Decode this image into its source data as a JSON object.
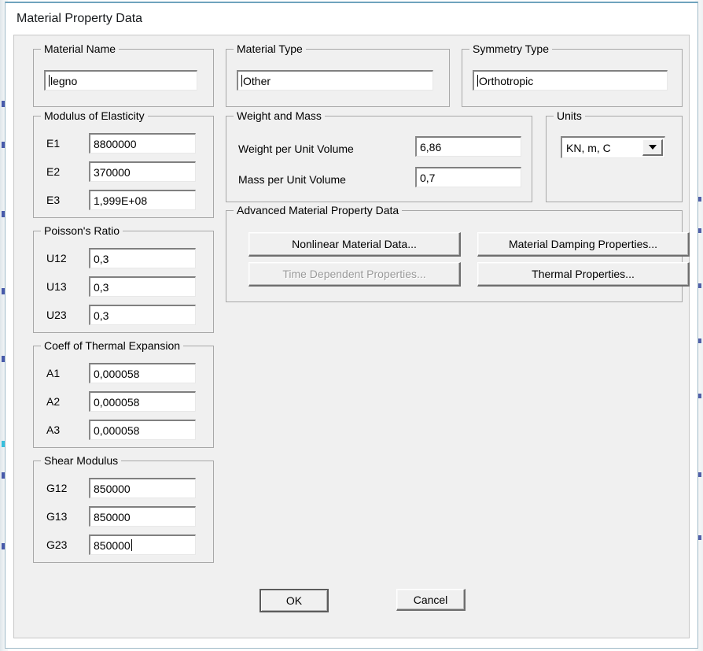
{
  "window": {
    "title": "Material Property Data"
  },
  "material_name": {
    "legend": "Material Name",
    "value": "legno"
  },
  "material_type": {
    "legend": "Material Type",
    "value": "Other"
  },
  "symmetry_type": {
    "legend": "Symmetry Type",
    "value": "Orthotropic"
  },
  "modulus_of_elasticity": {
    "legend": "Modulus of Elasticity",
    "rows": [
      {
        "label": "E1",
        "value": "8800000"
      },
      {
        "label": "E2",
        "value": "370000"
      },
      {
        "label": "E3",
        "value": "1,999E+08"
      }
    ]
  },
  "poissons_ratio": {
    "legend": "Poisson's Ratio",
    "rows": [
      {
        "label": "U12",
        "value": "0,3"
      },
      {
        "label": "U13",
        "value": "0,3"
      },
      {
        "label": "U23",
        "value": "0,3"
      }
    ]
  },
  "thermal_expansion": {
    "legend": "Coeff of Thermal Expansion",
    "rows": [
      {
        "label": "A1",
        "value": "0,000058"
      },
      {
        "label": "A2",
        "value": "0,000058"
      },
      {
        "label": "A3",
        "value": "0,000058"
      }
    ]
  },
  "shear_modulus": {
    "legend": "Shear Modulus",
    "rows": [
      {
        "label": "G12",
        "value": "850000"
      },
      {
        "label": "G13",
        "value": "850000"
      },
      {
        "label": "G23",
        "value": "850000"
      }
    ]
  },
  "weight_and_mass": {
    "legend": "Weight and Mass",
    "rows": [
      {
        "label": "Weight per Unit Volume",
        "value": "6,86"
      },
      {
        "label": "Mass per Unit Volume",
        "value": "0,7"
      }
    ]
  },
  "units": {
    "legend": "Units",
    "selected": "KN, m, C",
    "dropdown_icon": "chevron-down-icon"
  },
  "advanced": {
    "legend": "Advanced Material Property Data",
    "buttons": [
      {
        "label": "Nonlinear Material Data...",
        "enabled": true
      },
      {
        "label": "Material Damping Properties...",
        "enabled": true
      },
      {
        "label": "Time Dependent Properties...",
        "enabled": false
      },
      {
        "label": "Thermal Properties...",
        "enabled": true
      }
    ]
  },
  "footer": {
    "ok_label": "OK",
    "cancel_label": "Cancel"
  },
  "colors": {
    "dialog_face": "#f0f0f0",
    "field_background": "#ffffff",
    "border": "#a8a8a8",
    "title_accent": "#6fa3bd",
    "disabled_text": "#9a9a9a"
  }
}
